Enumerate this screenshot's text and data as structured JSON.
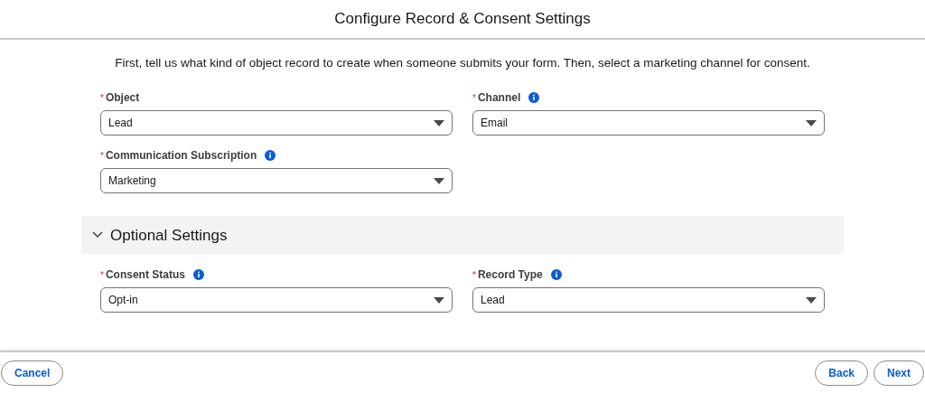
{
  "title": "Configure Record & Consent Settings",
  "intro": "First, tell us what kind of object record to create when someone submits your form. Then, select a marketing channel for consent.",
  "fields": [
    {
      "required_mark": "*",
      "label": "Object",
      "info": false,
      "value": "Lead"
    },
    {
      "required_mark": "*",
      "label": "Channel",
      "info": true,
      "value": "Email"
    },
    {
      "required_mark": "*",
      "label": "Communication Subscription",
      "info": true,
      "value": "Marketing"
    }
  ],
  "optional_section": {
    "title": "Optional Settings",
    "expanded": true,
    "fields": [
      {
        "required_mark": "*",
        "label": "Consent Status",
        "info": true,
        "value": "Opt-in"
      },
      {
        "required_mark": "*",
        "label": "Record Type",
        "info": true,
        "value": "Lead"
      }
    ]
  },
  "footer": {
    "cancel": "Cancel",
    "back": "Back",
    "next": "Next"
  }
}
